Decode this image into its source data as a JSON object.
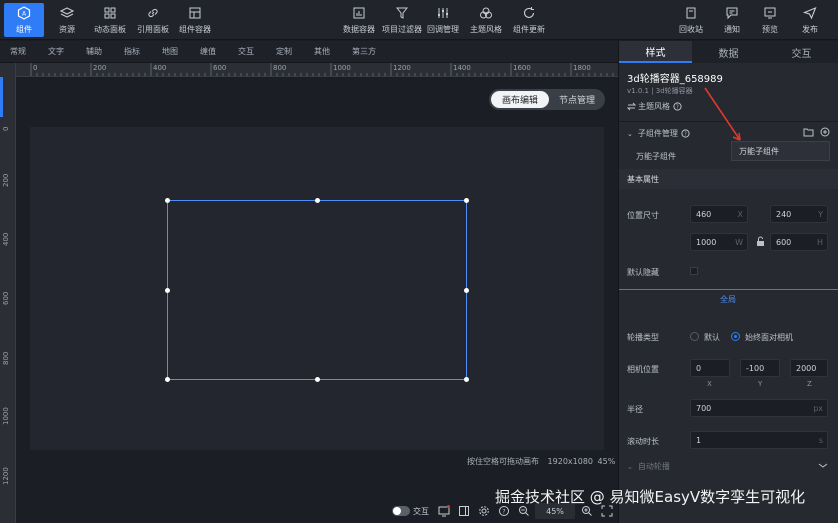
{
  "toolbar": {
    "left": [
      {
        "label": "组件",
        "icon": "component-icon",
        "active": true
      },
      {
        "label": "资源",
        "icon": "layers-icon"
      },
      {
        "label": "动态面板",
        "icon": "grid-icon"
      },
      {
        "label": "引用面板",
        "icon": "link-icon"
      },
      {
        "label": "组件容器",
        "icon": "container-icon"
      }
    ],
    "center": [
      {
        "label": "数据容器",
        "icon": "data-container-icon"
      },
      {
        "label": "项目过滤器",
        "icon": "filter-icon"
      },
      {
        "label": "回调管理",
        "icon": "sliders-icon"
      },
      {
        "label": "主题风格",
        "icon": "palette-icon"
      },
      {
        "label": "组件更新",
        "icon": "refresh-icon"
      }
    ],
    "right": [
      {
        "label": "回收站",
        "icon": "trash-icon"
      },
      {
        "label": "通知",
        "icon": "message-icon"
      },
      {
        "label": "预览",
        "icon": "preview-icon"
      },
      {
        "label": "发布",
        "icon": "send-icon"
      }
    ]
  },
  "categories": [
    "常规",
    "文字",
    "辅助",
    "指标",
    "地图",
    "缠值",
    "交互",
    "定制",
    "其他",
    "第三方"
  ],
  "ruler": {
    "h_ticks": [
      "0",
      "200",
      "400",
      "600",
      "800",
      "1000",
      "1200",
      "1400",
      "1600",
      "1800"
    ],
    "v_ticks": [
      "0",
      "200",
      "400",
      "600",
      "800",
      "1000",
      "1200"
    ]
  },
  "canvas": {
    "mode_edit": "画布编辑",
    "mode_node": "节点管理",
    "hint": "按住空格可拖动画布",
    "size": "1920x1080",
    "zoom": "45%"
  },
  "bottombar": {
    "interaction_label": "交互",
    "zoom": "45%"
  },
  "watermark": "掘金技术社区 @ 易知微EasyV数字孪生可视化",
  "panel": {
    "tabs": [
      "样式",
      "数据",
      "交互"
    ],
    "component_name": "3d轮播容器_658989",
    "component_version": "v1.0.1 | 3d轮播容器",
    "theme_label": "主题风格",
    "child_manager": "子组件管理",
    "child_item": "万能子组件",
    "popup_item": "万能子组件",
    "basic_props": "基本属性",
    "pos_size_label": "位置尺寸",
    "x": "460",
    "x_unit": "X",
    "y": "240",
    "y_unit": "Y",
    "w": "1000",
    "w_unit": "W",
    "h": "600",
    "h_unit": "H",
    "hide_label": "默认隐藏",
    "global_label": "全局",
    "carousel_type_label": "轮播类型",
    "opt_default": "默认",
    "opt_face": "始终面对相机",
    "camera_pos_label": "相机位置",
    "cam_x": "0",
    "cam_x_unit": "X",
    "cam_y": "-100",
    "cam_y_unit": "Y",
    "cam_z": "2000",
    "cam_z_unit": "Z",
    "radius_label": "半径",
    "radius": "700",
    "radius_unit": "px",
    "scroll_label": "滚动时长",
    "scroll": "1",
    "scroll_unit": "s",
    "autoplay_label": "自动轮播"
  },
  "colors": {
    "accent": "#2f7cf6",
    "arrow": "#e0392c"
  }
}
